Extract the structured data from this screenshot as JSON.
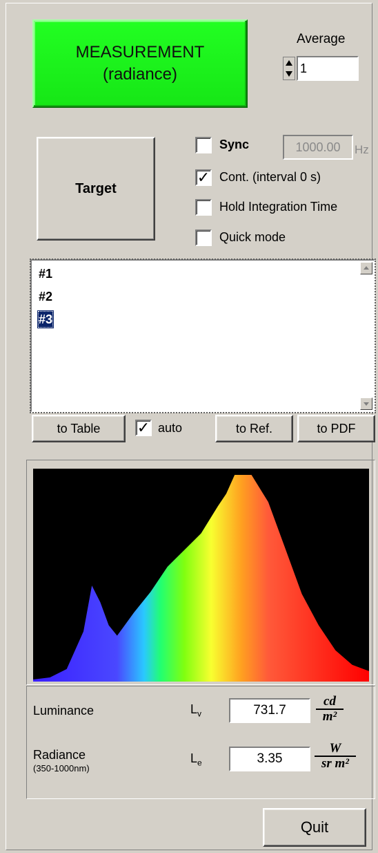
{
  "measurement_button": {
    "line1": "MEASUREMENT",
    "line2": "(radiance)"
  },
  "average": {
    "label": "Average",
    "value": "1"
  },
  "target_button": {
    "label": "Target"
  },
  "options": {
    "sync": {
      "label": "Sync",
      "checked": false,
      "frequency": "1000.00",
      "unit": "Hz"
    },
    "cont": {
      "label": "Cont. (interval 0 s)",
      "checked": true
    },
    "hold": {
      "label": "Hold Integration Time",
      "checked": false
    },
    "quick": {
      "label": "Quick mode",
      "checked": false
    }
  },
  "list": {
    "items": [
      "#1",
      "#2",
      "#3"
    ],
    "selected_index": 2
  },
  "actions": {
    "to_table": "to Table",
    "auto": {
      "label": "auto",
      "checked": true
    },
    "to_ref": "to Ref.",
    "to_pdf": "to PDF"
  },
  "chart_data": {
    "type": "area",
    "x_unit_hint": "wavelength (nm)",
    "x": [
      380,
      400,
      420,
      440,
      450,
      460,
      470,
      480,
      500,
      520,
      540,
      560,
      580,
      600,
      610,
      620,
      640,
      660,
      680,
      700,
      720,
      740,
      760,
      780
    ],
    "values": [
      0.01,
      0.02,
      0.06,
      0.24,
      0.46,
      0.38,
      0.27,
      0.22,
      0.33,
      0.43,
      0.55,
      0.63,
      0.71,
      0.84,
      0.9,
      0.99,
      0.99,
      0.86,
      0.64,
      0.42,
      0.27,
      0.15,
      0.08,
      0.05
    ],
    "ylim": [
      0,
      1
    ],
    "grid": false
  },
  "readouts": {
    "luminance": {
      "label": "Luminance",
      "symbol": "L",
      "subscript": "v",
      "value": "731.7",
      "unit_num": "cd",
      "unit_den": "m²"
    },
    "radiance": {
      "label": "Radiance",
      "sublabel": "(350-1000nm)",
      "symbol": "L",
      "subscript": "e",
      "value": "3.35",
      "unit_num": "W",
      "unit_den": "sr m²"
    }
  },
  "quit_button": {
    "label": "Quit"
  }
}
